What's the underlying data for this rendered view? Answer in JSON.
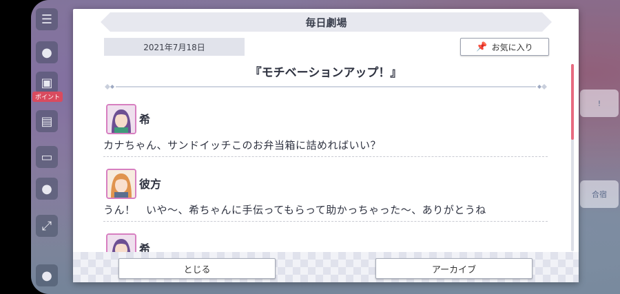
{
  "dialog": {
    "title": "毎日劇場",
    "date": "2021年7月18日",
    "favorite_label": "お気に入り",
    "story_title": "『モチベーションアップ！』"
  },
  "lines": [
    {
      "speaker": "希",
      "text": "カナちゃん、サンドイッチこのお弁当箱に詰めればいい？",
      "avatar_color": "#7b5fa8"
    },
    {
      "speaker": "彼方",
      "text": "うん！　いや〜、希ちゃんに手伝ってもらって助かっちゃった〜、ありがとうね",
      "avatar_color": "#e0944f"
    },
    {
      "speaker": "希",
      "text": "",
      "avatar_color": "#7b5fa8"
    }
  ],
  "footer": {
    "close_label": "とじる",
    "archive_label": "アーカイブ"
  },
  "side": {
    "tag_label": "ポイント",
    "right_label": "合宿"
  },
  "colors": {
    "accent": "#e86b80",
    "avatar_border": "#d77ec0"
  }
}
